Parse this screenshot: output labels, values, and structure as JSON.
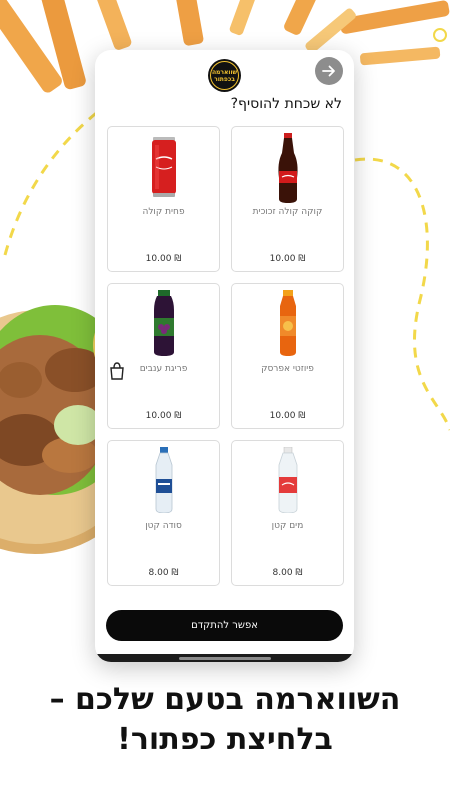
{
  "header": {
    "title": "לא שכחת להוסיף?",
    "logo_text": "שווארמה בכפתור"
  },
  "products": [
    {
      "name": "קוקה קולה זכוכית",
      "price": "10.00 ₪",
      "icon": "glass-coke-bottle-icon"
    },
    {
      "name": "פחית קולה",
      "price": "10.00 ₪",
      "icon": "cola-can-icon"
    },
    {
      "name": "פיוזטי אפרסק",
      "price": "10.00 ₪",
      "icon": "fuze-tea-bottle-icon"
    },
    {
      "name": "פריגת ענבים",
      "price": "10.00 ₪",
      "icon": "grape-juice-bottle-icon"
    },
    {
      "name": "מים קטן",
      "price": "8.00 ₪",
      "icon": "small-water-bottle-icon"
    },
    {
      "name": "סודה קטן",
      "price": "8.00 ₪",
      "icon": "small-soda-bottle-icon"
    }
  ],
  "cta": {
    "label": "אפשר להתקדם"
  },
  "caption": {
    "line1": "השווארמה בטעם שלכם –",
    "line2": "בלחיצת כפתור!"
  },
  "colors": {
    "accent_yellow": "#f2d84a",
    "button_black": "#0a0a0a",
    "back_button": "#8d8d8d"
  }
}
